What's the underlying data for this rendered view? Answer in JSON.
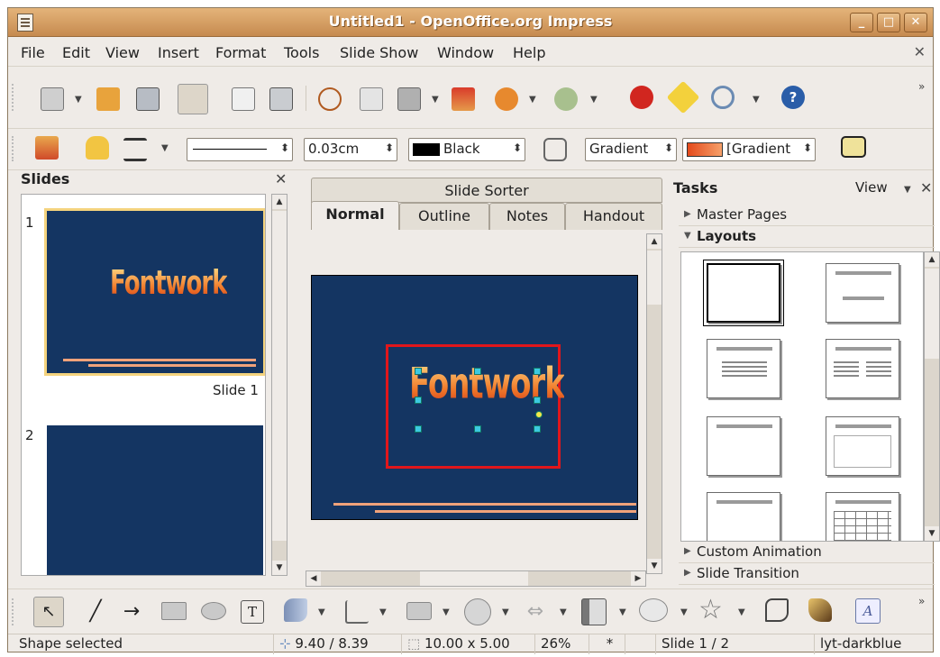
{
  "window": {
    "title": "Untitled1 - OpenOffice.org Impress",
    "minimize": "_",
    "maximize": "□",
    "close": "✕"
  },
  "menu": {
    "items": [
      "File",
      "Edit",
      "View",
      "Insert",
      "Format",
      "Tools",
      "Slide Show",
      "Window",
      "Help"
    ],
    "close": "✕"
  },
  "line_toolbar": {
    "line_width": "0.03cm",
    "line_color": "Black",
    "area_style": "Gradient",
    "area_fill": "[Gradient"
  },
  "slides_pane": {
    "title": "Slides",
    "close": "✕",
    "slides": [
      {
        "number": "1",
        "label": "Slide 1",
        "fontwork": "Fontwork"
      },
      {
        "number": "2",
        "label": ""
      }
    ]
  },
  "center": {
    "sorter_tab": "Slide Sorter",
    "tabs": [
      "Normal",
      "Outline",
      "Notes",
      "Handout"
    ],
    "fontwork": "Fontwork"
  },
  "tasks": {
    "title": "Tasks",
    "view": "View",
    "close": "✕",
    "sections": {
      "master_pages": "Master Pages",
      "layouts": "Layouts",
      "custom_animation": "Custom Animation",
      "slide_transition": "Slide Transition"
    }
  },
  "status": {
    "message": "Shape selected",
    "position": "9.40 / 8.39",
    "size": "10.00 x 5.00",
    "zoom": "26%",
    "modified": "*",
    "slide": "Slide 1 / 2",
    "layout": "lyt-darkblue"
  },
  "colors": {
    "slide_bg": "#143562",
    "selection": "#e0161b",
    "title_bar": "#d19a5e"
  }
}
